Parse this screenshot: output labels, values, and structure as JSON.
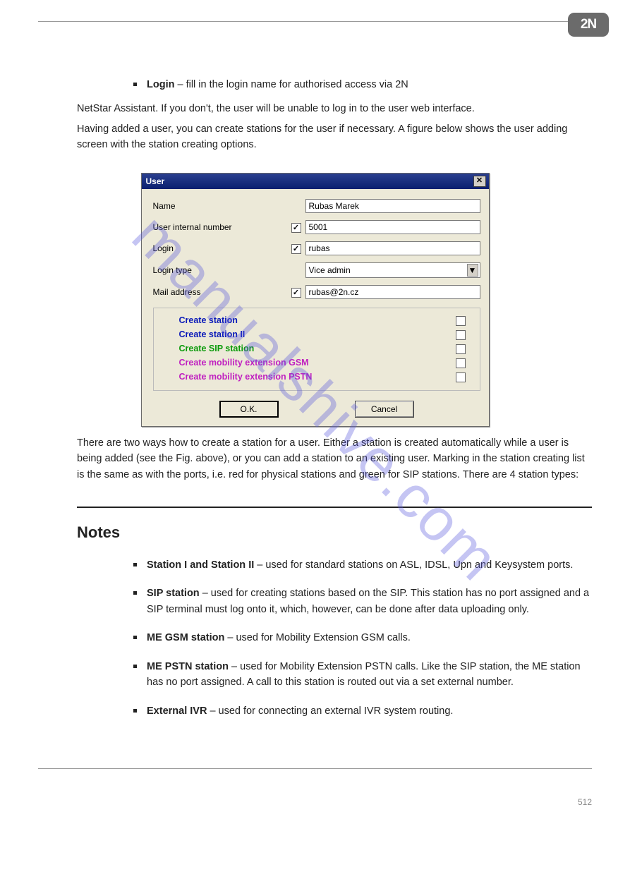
{
  "logo_text": "2N",
  "watermark": "manualshive.com",
  "intro_bullet": {
    "lead": "Login",
    "text": " – fill in the login name for authorised access via 2N"
  },
  "para1": "NetStar Assistant. If you don't, the user will be unable to log in to the user web interface.",
  "para2": "Having added a user, you can create stations for the user if necessary. A figure below shows the user adding screen with the station creating options.",
  "dialog": {
    "title": "User",
    "fields": {
      "name": {
        "label": "Name",
        "value": "Rubas Marek",
        "hasCheck": false
      },
      "uin": {
        "label": "User internal number",
        "value": "5001",
        "checked": true
      },
      "login": {
        "label": "Login",
        "value": "rubas",
        "checked": true
      },
      "ltype": {
        "label": "Login type",
        "value": "Vice admin"
      },
      "mail": {
        "label": "Mail address",
        "value": "rubas@2n.cz",
        "checked": true
      }
    },
    "group": [
      {
        "label": "Create station",
        "cls": "c-navy",
        "checked": false
      },
      {
        "label": "Create station II",
        "cls": "c-navy",
        "checked": false
      },
      {
        "label": "Create SIP station",
        "cls": "c-green",
        "checked": false
      },
      {
        "label": "Create mobility extension GSM",
        "cls": "c-magenta",
        "checked": false
      },
      {
        "label": "Create mobility extension PSTN",
        "cls": "c-magenta",
        "checked": false
      }
    ],
    "ok": "O.K.",
    "cancel": "Cancel"
  },
  "after_dialog": "There are two ways how to create a station for a user. Either a station is created automatically while a user is being added (see the Fig. above), or you can add a station to an existing user. Marking in the station creating list is the same as with the ports, i.e. red for physical stations and green for SIP stations. There are 4 station types:",
  "notes_title": "Notes",
  "notes": [
    {
      "lead": "Station I and Station II",
      "text": " – used for standard stations on ASL, IDSL, Upn and Keysystem ports."
    },
    {
      "lead": "SIP station",
      "text": " – used for creating stations based on the SIP. This station has no port assigned and a SIP terminal must log onto it, which, however, can be done after data uploading only."
    },
    {
      "lead": "ME GSM station",
      "text": " – used for Mobility Extension GSM calls."
    },
    {
      "lead": "ME PSTN station",
      "text": " – used for Mobility Extension PSTN calls. Like the SIP station, the ME station has no port assigned. A call to this station is routed out via a set external number."
    },
    {
      "lead": "External IVR",
      "text": " – used for connecting an external IVR system routing."
    }
  ],
  "page_no": "512"
}
